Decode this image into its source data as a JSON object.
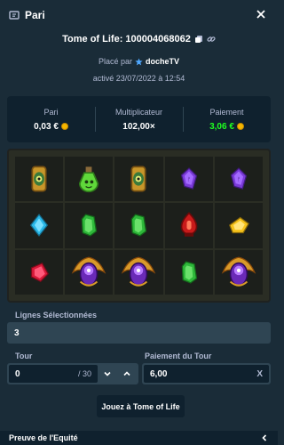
{
  "modal": {
    "title": "Pari",
    "close_icon": "close-icon",
    "bet_icon": "ticket-icon"
  },
  "bet": {
    "game_line": "Tome of Life: 100004068062",
    "placed_prefix": "Placé par",
    "user": "docheTV",
    "activated": "activé 23/07/2022 à 12:54"
  },
  "stats": {
    "bet_label": "Pari",
    "bet_value": "0,03 €",
    "multiplier_label": "Multiplicateur",
    "multiplier_value": "102,00×",
    "payout_label": "Paiement",
    "payout_value": "3,06 €",
    "payout_color": "#1fff20"
  },
  "board": {
    "rows": [
      [
        "gold-eye-amulet",
        "green-potion",
        "gold-eye-amulet",
        "purple-gem",
        "purple-gem"
      ],
      [
        "blue-gem",
        "green-gem",
        "green-gem",
        "red-lantern",
        "yellow-gem"
      ],
      [
        "red-gem",
        "scarab-wild",
        "scarab-wild",
        "green-gem",
        "scarab-wild"
      ]
    ]
  },
  "form": {
    "lines_label": "Lignes Sélectionnées",
    "lines_value": "3",
    "tour_label": "Tour",
    "tour_value": "0",
    "tour_suffix": "/ 30",
    "payout_tour_label": "Paiement du Tour",
    "payout_tour_value": "6,00",
    "payout_tour_unit": "X",
    "play_button": "Jouez à Tome of Life"
  },
  "footer": {
    "label": "Preuve de l'Equité"
  }
}
